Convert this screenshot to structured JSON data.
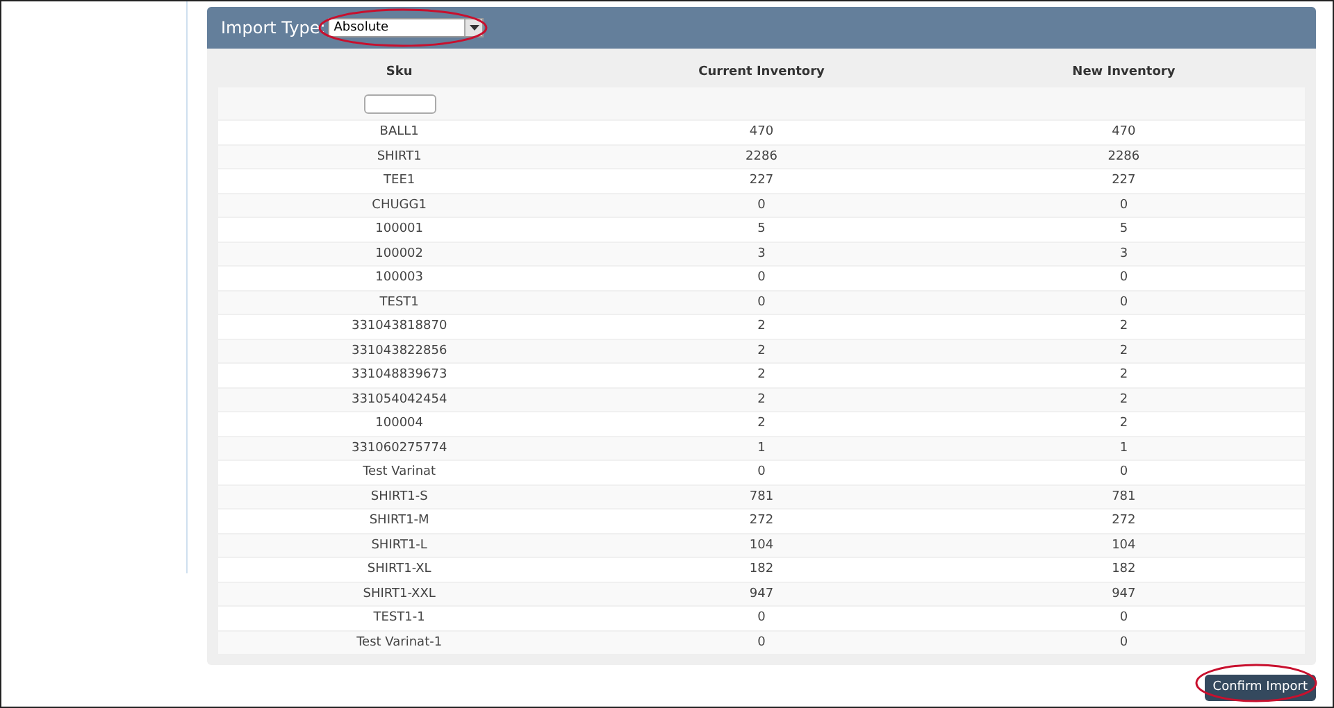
{
  "import_type": {
    "label": "Import Type:",
    "value": "Absolute"
  },
  "table": {
    "columns": [
      "Sku",
      "Current Inventory",
      "New Inventory"
    ],
    "rows": [
      [
        "BALL1",
        "470",
        "470"
      ],
      [
        "SHIRT1",
        "2286",
        "2286"
      ],
      [
        "TEE1",
        "227",
        "227"
      ],
      [
        "CHUGG1",
        "0",
        "0"
      ],
      [
        "100001",
        "5",
        "5"
      ],
      [
        "100002",
        "3",
        "3"
      ],
      [
        "100003",
        "0",
        "0"
      ],
      [
        "TEST1",
        "0",
        "0"
      ],
      [
        "331043818870",
        "2",
        "2"
      ],
      [
        "331043822856",
        "2",
        "2"
      ],
      [
        "331048839673",
        "2",
        "2"
      ],
      [
        "331054042454",
        "2",
        "2"
      ],
      [
        "100004",
        "2",
        "2"
      ],
      [
        "331060275774",
        "1",
        "1"
      ],
      [
        "Test Varinat",
        "0",
        "0"
      ],
      [
        "SHIRT1-S",
        "781",
        "781"
      ],
      [
        "SHIRT1-M",
        "272",
        "272"
      ],
      [
        "SHIRT1-L",
        "104",
        "104"
      ],
      [
        "SHIRT1-XL",
        "182",
        "182"
      ],
      [
        "SHIRT1-XXL",
        "947",
        "947"
      ],
      [
        "TEST1-1",
        "0",
        "0"
      ],
      [
        "Test Varinat-1",
        "0",
        "0"
      ]
    ]
  },
  "confirm_button": "Confirm Import"
}
